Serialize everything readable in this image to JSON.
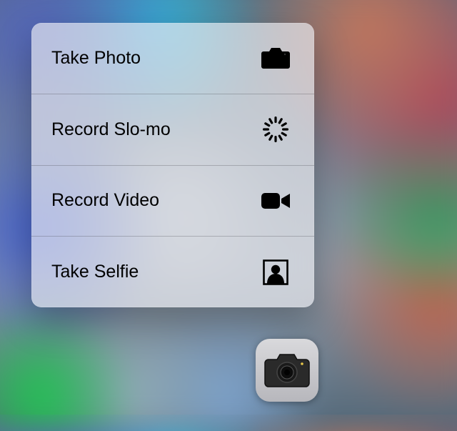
{
  "quick_actions": {
    "items": [
      {
        "label": "Take Photo",
        "icon": "camera-icon"
      },
      {
        "label": "Record Slo-mo",
        "icon": "slomo-icon"
      },
      {
        "label": "Record Video",
        "icon": "video-icon"
      },
      {
        "label": "Take Selfie",
        "icon": "selfie-icon"
      }
    ]
  },
  "app": {
    "name": "Camera",
    "icon": "camera-app-icon"
  }
}
